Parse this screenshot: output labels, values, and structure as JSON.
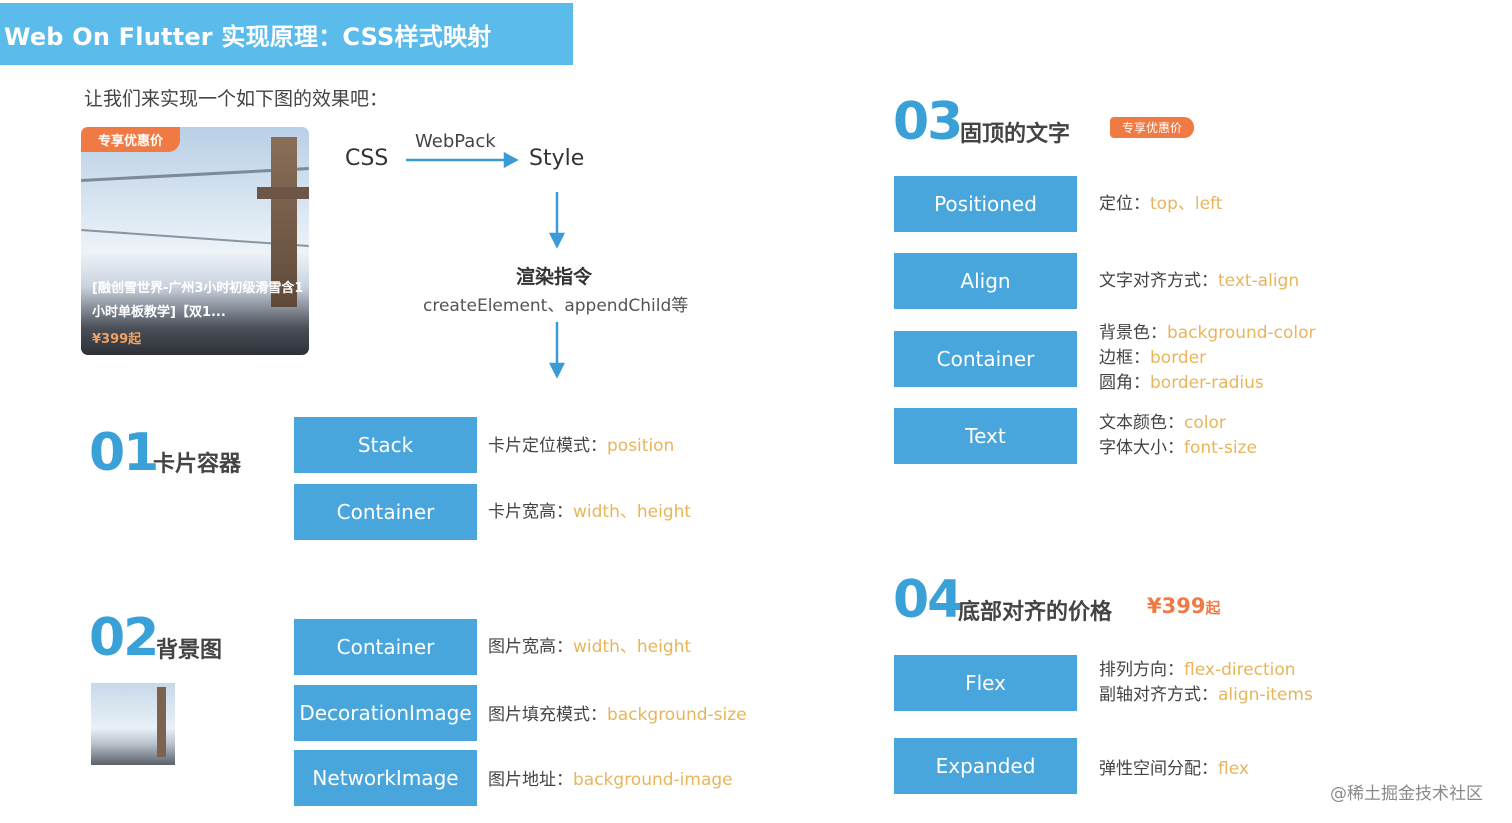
{
  "title": "Web On Flutter 实现原理：CSS样式映射",
  "intro": "让我们来实现一个如下图的效果吧：",
  "card": {
    "tag": "专享优惠价",
    "title": "[融创雪世界-广州3小时初级滑雪含1小时单板教学]【双1...",
    "price": "¥399起"
  },
  "flow": {
    "source": "CSS",
    "tool": "WebPack",
    "target": "Style",
    "render_title": "渲染指令",
    "render_calls": "createElement、appendChild等"
  },
  "sections": {
    "s01": {
      "num": "01",
      "title": "卡片容器",
      "rows": [
        {
          "widget": "Stack",
          "label": "卡片定位模式：",
          "value": "position"
        },
        {
          "widget": "Container",
          "label": "卡片宽高：",
          "value": "width、height"
        }
      ]
    },
    "s02": {
      "num": "02",
      "title": "背景图",
      "rows": [
        {
          "widget": "Container",
          "label": "图片宽高：",
          "value": "width、height"
        },
        {
          "widget": "DecorationImage",
          "label": "图片填充模式：",
          "value": "background-size"
        },
        {
          "widget": "NetworkImage",
          "label": "图片地址：",
          "value": "background-image"
        }
      ]
    },
    "s03": {
      "num": "03",
      "title": "固顶的文字",
      "badge": "专享优惠价",
      "rows": [
        {
          "widget": "Positioned",
          "label": "定位：",
          "value": "top、left"
        },
        {
          "widget": "Align",
          "label": "文字对齐方式：",
          "value": "text-align"
        },
        {
          "widget": "Container",
          "lines": [
            {
              "label": "背景色：",
              "value": "background-color"
            },
            {
              "label": "边框：",
              "value": "border"
            },
            {
              "label": "圆角：",
              "value": "border-radius"
            }
          ]
        },
        {
          "widget": "Text",
          "lines": [
            {
              "label": "文本颜色：",
              "value": "color"
            },
            {
              "label": "字体大小：",
              "value": "font-size"
            }
          ]
        }
      ]
    },
    "s04": {
      "num": "04",
      "title": "底部对齐的价格",
      "price_symbol": "¥399",
      "price_suffix": "起",
      "rows": [
        {
          "widget": "Flex",
          "lines": [
            {
              "label": "排列方向：",
              "value": "flex-direction"
            },
            {
              "label": "副轴对齐方式：",
              "value": "align-items"
            }
          ]
        },
        {
          "widget": "Expanded",
          "label": "弹性空间分配：",
          "value": "flex"
        }
      ]
    }
  },
  "watermark": "@稀土掘金技术社区",
  "colors": {
    "banner": "#5bbcec",
    "widget_box": "#48a6dc",
    "section_number": "#39a0d8",
    "highlight": "#e8b55a",
    "price_orange": "#f07a44"
  }
}
